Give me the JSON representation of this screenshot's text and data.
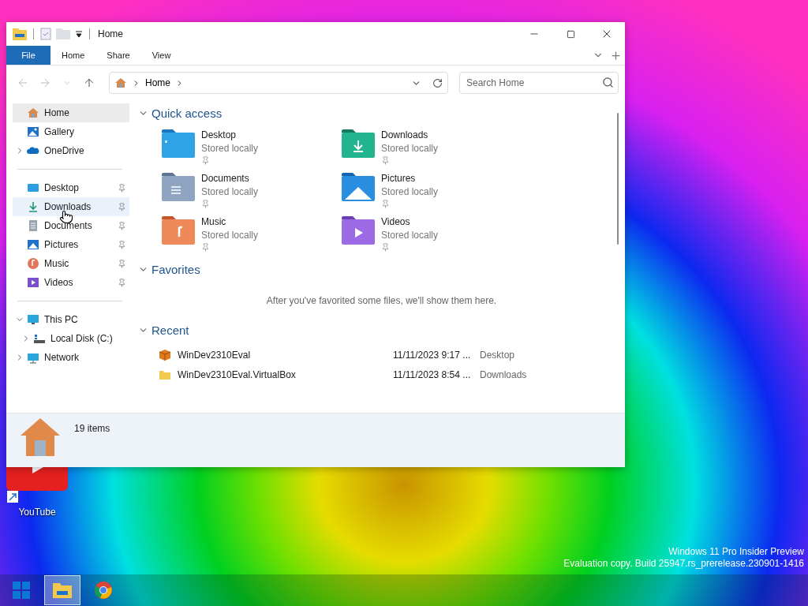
{
  "window": {
    "title": "Home"
  },
  "ribbon_tabs": [
    {
      "label": "File",
      "selected": true
    },
    {
      "label": "Home",
      "selected": false
    },
    {
      "label": "Share",
      "selected": false
    },
    {
      "label": "View",
      "selected": false
    }
  ],
  "nav_buttons": [
    {
      "kind": "back",
      "disabled": true
    },
    {
      "kind": "forward",
      "disabled": true
    },
    {
      "kind": "recent",
      "disabled": true
    },
    {
      "kind": "up",
      "disabled": false
    }
  ],
  "address_bar": {
    "crumbs": [
      "Home"
    ]
  },
  "search": {
    "placeholder": "Search Home"
  },
  "sidebar": {
    "groups": [
      {
        "items": [
          {
            "label": "Home",
            "kind": "home",
            "selected": true,
            "hovered": false,
            "pinned": false
          },
          {
            "label": "Gallery",
            "kind": "gallery",
            "selected": false,
            "hovered": false,
            "pinned": false
          },
          {
            "label": "OneDrive",
            "kind": "cloud",
            "selected": false,
            "hovered": false,
            "pinned": false,
            "expanded": false
          }
        ]
      },
      {
        "items": [
          {
            "label": "Desktop",
            "kind": "desktop",
            "selected": false,
            "hovered": false,
            "pinned": true
          },
          {
            "label": "Downloads",
            "kind": "download",
            "selected": false,
            "hovered": true,
            "pinned": true
          },
          {
            "label": "Documents",
            "kind": "document",
            "selected": false,
            "hovered": false,
            "pinned": true
          },
          {
            "label": "Pictures",
            "kind": "picture",
            "selected": false,
            "hovered": false,
            "pinned": true
          },
          {
            "label": "Music",
            "kind": "music",
            "selected": false,
            "hovered": false,
            "pinned": true
          },
          {
            "label": "Videos",
            "kind": "video",
            "selected": false,
            "hovered": false,
            "pinned": true
          }
        ]
      },
      {
        "items": [
          {
            "label": "This PC",
            "kind": "pc",
            "selected": false,
            "hovered": false,
            "pinned": false,
            "expanded": true,
            "children": [
              {
                "label": "Local Disk (C:)",
                "kind": "disk",
                "selected": false,
                "hovered": false,
                "pinned": false,
                "expanded": false
              }
            ]
          },
          {
            "label": "Network",
            "kind": "network",
            "selected": false,
            "hovered": false,
            "pinned": false,
            "expanded": false
          }
        ]
      }
    ]
  },
  "sections": [
    {
      "kind": "grid",
      "title": "Quick access",
      "expanded": true,
      "items": [
        {
          "name": "Desktop",
          "status": "Stored locally",
          "kind": "desktop",
          "pinned": true
        },
        {
          "name": "Downloads",
          "status": "Stored locally",
          "kind": "download",
          "pinned": true
        },
        {
          "name": "Documents",
          "status": "Stored locally",
          "kind": "document",
          "pinned": true
        },
        {
          "name": "Pictures",
          "status": "Stored locally",
          "kind": "picture",
          "pinned": true
        },
        {
          "name": "Music",
          "status": "Stored locally",
          "kind": "music",
          "pinned": true
        },
        {
          "name": "Videos",
          "status": "Stored locally",
          "kind": "video",
          "pinned": true
        }
      ]
    },
    {
      "kind": "message",
      "title": "Favorites",
      "expanded": true,
      "message": "After you've favorited some files, we'll show them here."
    },
    {
      "kind": "list",
      "title": "Recent",
      "expanded": true,
      "rows": [
        {
          "name": "WinDev2310Eval",
          "date": "11/11/2023 9:17 ...",
          "location": "Desktop",
          "kind": "package"
        },
        {
          "name": "WinDev2310Eval.VirtualBox",
          "date": "11/11/2023 8:54 ...",
          "location": "Downloads",
          "kind": "folder"
        }
      ]
    }
  ],
  "status_bar": {
    "count": "19 items"
  },
  "desktop": {
    "icons": [
      {
        "label": "YouTube"
      }
    ],
    "watermark": [
      "Windows 11 Pro Insider Preview",
      "Evaluation copy. Build 25947.rs_prerelease.230901-1416"
    ]
  },
  "taskbar": {
    "apps": [
      {
        "kind": "start",
        "active": false
      },
      {
        "kind": "explorer",
        "active": true
      },
      {
        "kind": "chrome",
        "active": false
      }
    ]
  }
}
